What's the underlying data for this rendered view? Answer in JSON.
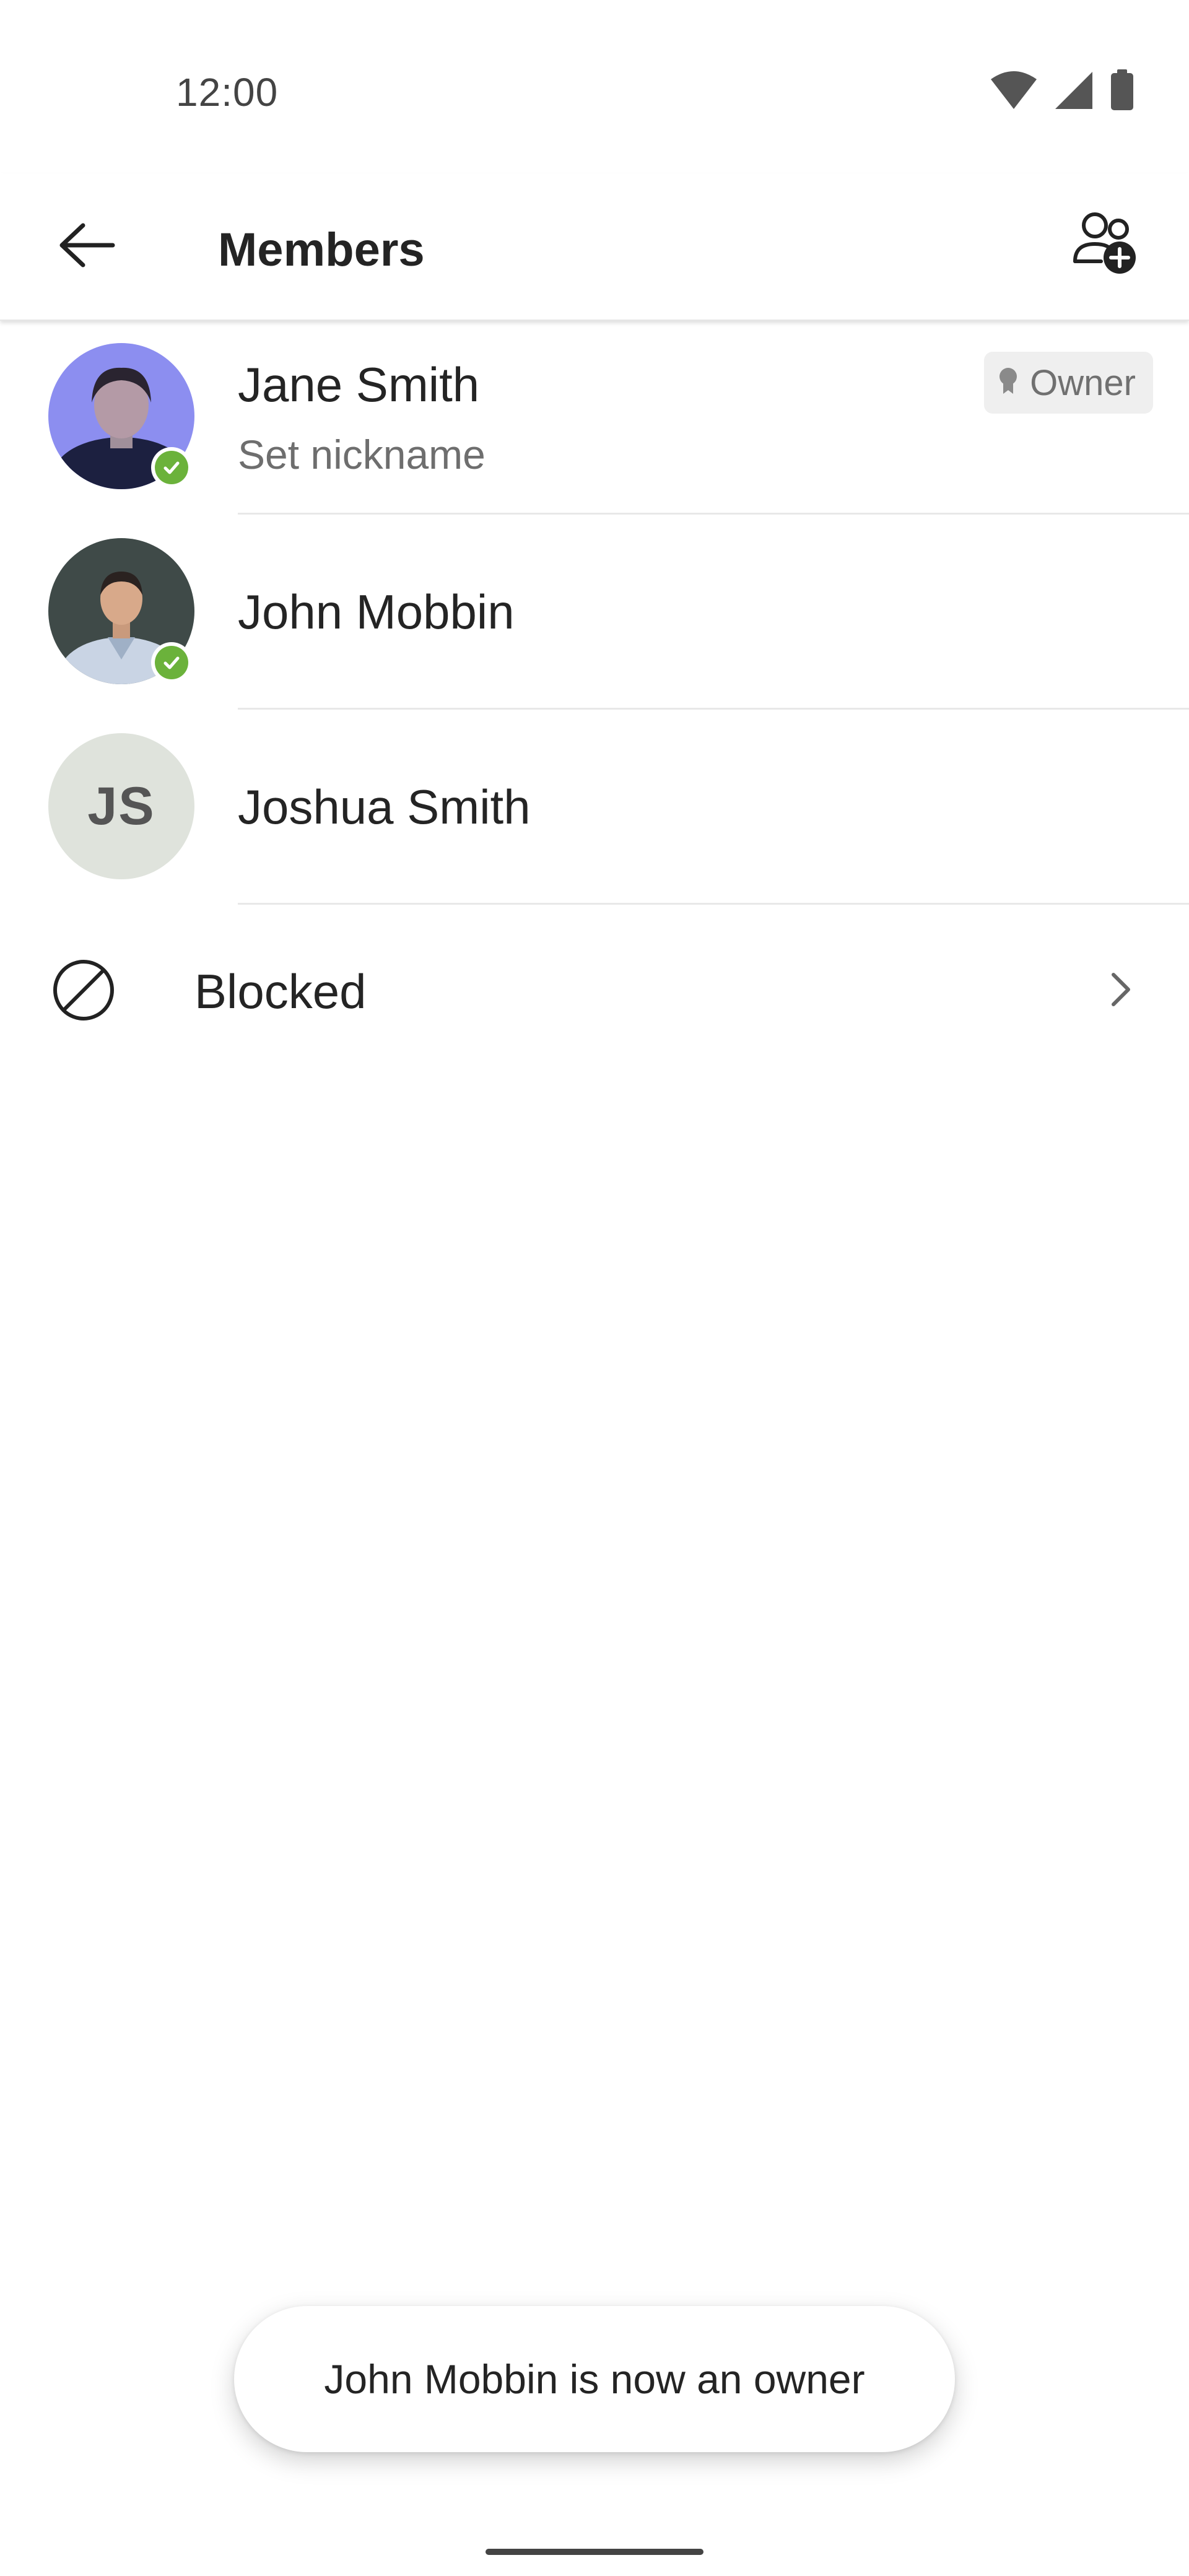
{
  "status_bar": {
    "time": "12:00",
    "icons": [
      "wifi-icon",
      "cellular-signal-icon",
      "battery-icon"
    ]
  },
  "app_bar": {
    "title": "Members",
    "back_icon": "arrow-left-icon",
    "add_icon": "add-person-icon"
  },
  "members": [
    {
      "name": "Jane Smith",
      "subtitle": "Set nickname",
      "badge": "Owner",
      "presence": "available",
      "avatar": "photo"
    },
    {
      "name": "John Mobbin",
      "subtitle": "",
      "badge": "",
      "presence": "available",
      "avatar": "photo"
    },
    {
      "name": "Joshua Smith",
      "subtitle": "",
      "badge": "",
      "presence": "",
      "avatar": "initials",
      "initials": "JS"
    }
  ],
  "blocked": {
    "label": "Blocked",
    "icon": "block-icon",
    "chevron": "chevron-right-icon"
  },
  "toast": {
    "message": "John Mobbin is now an owner"
  },
  "colors": {
    "presence_available": "#6bb23b",
    "badge_bg": "#efefef",
    "text_primary": "#242424",
    "text_secondary": "#6e6e6e"
  }
}
